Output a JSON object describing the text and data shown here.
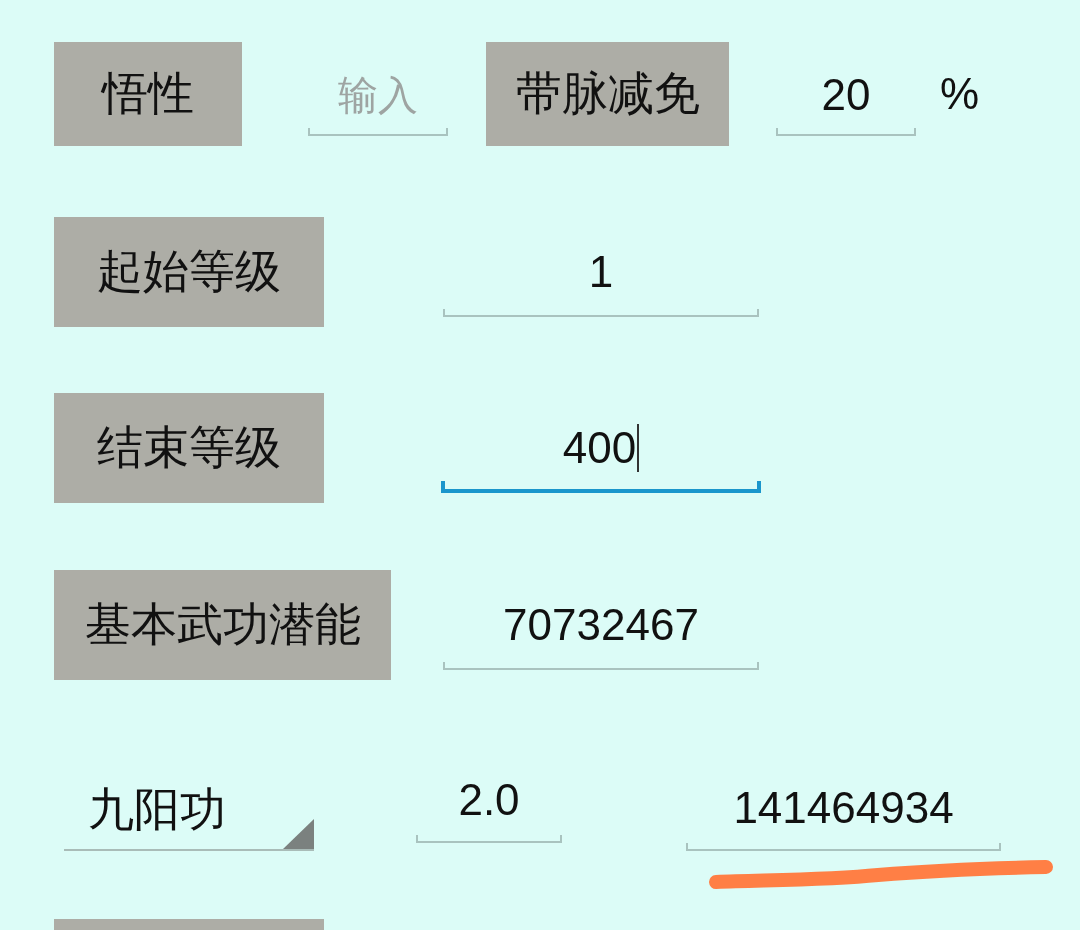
{
  "rows": [
    {
      "items": [
        {
          "kind": "button",
          "label": "悟性"
        },
        {
          "kind": "field",
          "placeholder": "输入",
          "focused": false,
          "highlighted": false
        },
        {
          "kind": "button",
          "label": "带脉减免"
        },
        {
          "kind": "field",
          "value": "20",
          "focused": false,
          "highlighted": false
        },
        {
          "kind": "unit",
          "text": "%"
        }
      ]
    },
    {
      "items": [
        {
          "kind": "button",
          "label": "起始等级"
        },
        {
          "kind": "field",
          "value": "1",
          "focused": false,
          "highlighted": false
        }
      ]
    },
    {
      "items": [
        {
          "kind": "button",
          "label": "结束等级"
        },
        {
          "kind": "field",
          "value": "400",
          "focused": true,
          "highlighted": false
        }
      ]
    },
    {
      "items": [
        {
          "kind": "button",
          "label": "基本武功潜能"
        },
        {
          "kind": "field",
          "value": "70732467",
          "focused": false,
          "highlighted": false
        }
      ]
    },
    {
      "items": [
        {
          "kind": "dropdown",
          "value": "九阳功"
        },
        {
          "kind": "field",
          "value": "2.0",
          "focused": false,
          "highlighted": false
        },
        {
          "kind": "field",
          "value": "141464934",
          "focused": false,
          "highlighted": true
        }
      ]
    },
    {
      "items": [
        {
          "kind": "button"
        }
      ]
    }
  ]
}
